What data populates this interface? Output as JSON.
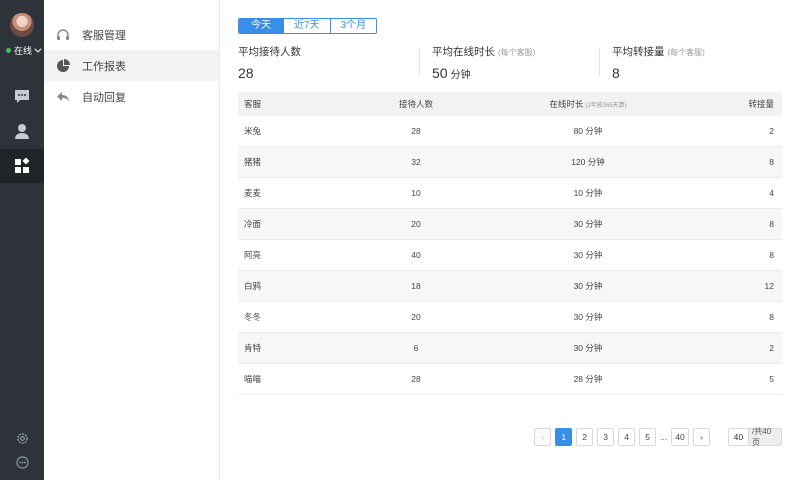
{
  "sidebar": {
    "status_label": "在线",
    "rail_icons": [
      "chat-icon",
      "user-icon",
      "dashboard-icon",
      "settings-icon",
      "more-icon"
    ]
  },
  "menu": {
    "items": [
      {
        "label": "客服管理",
        "icon": "headset-icon"
      },
      {
        "label": "工作报表",
        "icon": "pie-chart-icon"
      },
      {
        "label": "自动回复",
        "icon": "reply-icon"
      }
    ]
  },
  "range_tabs": [
    "今天",
    "近7天",
    "3个月"
  ],
  "stats": [
    {
      "label": "平均接待人数",
      "sub": "",
      "value": "28",
      "unit": ""
    },
    {
      "label": "平均在线时长",
      "sub": "(每个客服)",
      "value": "50",
      "unit": "分钟"
    },
    {
      "label": "平均转接量",
      "sub": "(每个客服)",
      "value": "8",
      "unit": ""
    }
  ],
  "table": {
    "headers": {
      "agent": "客服",
      "received": "接待人数",
      "online": "在线时长",
      "online_sub": "(1年按365天算)",
      "transfer": "转接量"
    },
    "rows": [
      {
        "agent": "米兔",
        "received": "28",
        "online": "80 分钟",
        "transfer": "2"
      },
      {
        "agent": "猪猪",
        "received": "32",
        "online": "120 分钟",
        "transfer": "8"
      },
      {
        "agent": "麦麦",
        "received": "10",
        "online": "10 分钟",
        "transfer": "4"
      },
      {
        "agent": "冷面",
        "received": "20",
        "online": "30 分钟",
        "transfer": "8"
      },
      {
        "agent": "阿亮",
        "received": "40",
        "online": "30 分钟",
        "transfer": "8"
      },
      {
        "agent": "白鸦",
        "received": "18",
        "online": "30 分钟",
        "transfer": "12"
      },
      {
        "agent": "冬冬",
        "received": "20",
        "online": "30 分钟",
        "transfer": "8"
      },
      {
        "agent": "肯特",
        "received": "6",
        "online": "30 分钟",
        "transfer": "2"
      },
      {
        "agent": "喵喵",
        "received": "28",
        "online": "28 分钟",
        "transfer": "5"
      }
    ]
  },
  "pagination": {
    "prev": "‹",
    "pages": [
      "1",
      "2",
      "3",
      "4",
      "5"
    ],
    "ellipsis": "...",
    "last": "40",
    "next": "›",
    "jump_value": "40",
    "total_label": "/共40页"
  },
  "colors": {
    "accent": "#3a8ee6",
    "rail": "#2d3339",
    "online": "#3fc35f"
  }
}
